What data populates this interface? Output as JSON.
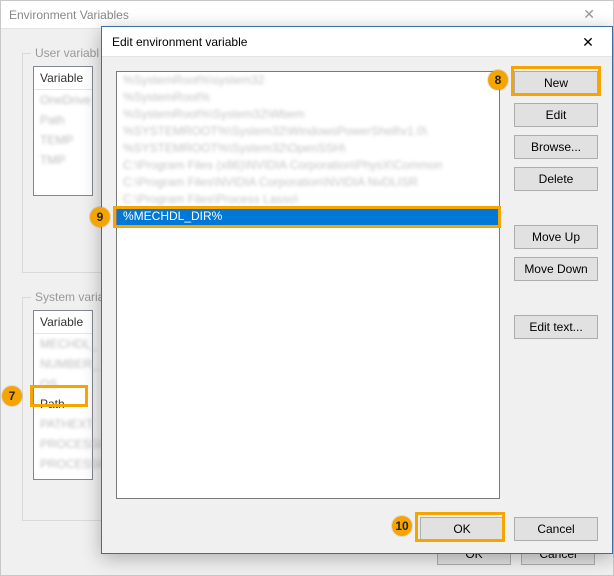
{
  "parent_dialog": {
    "title": "Environment Variables",
    "close_glyph": "✕",
    "user_group_label": "User variabl",
    "system_group_label": "System varia",
    "list_header": "Variable",
    "user_rows": [
      "OneDrive",
      "Path",
      "TEMP",
      "TMP"
    ],
    "system_rows": [
      "MECHDL_",
      "NUMBER_",
      "OS",
      "Path",
      "PATHEXT",
      "PROCESSC",
      "PROCESSC"
    ],
    "ok_label": "OK",
    "cancel_label": "Cancel"
  },
  "edit_dialog": {
    "title": "Edit environment variable",
    "close_glyph": "✕",
    "path_rows": [
      {
        "text": "%SystemRoot%\\system32",
        "selected": false
      },
      {
        "text": "%SystemRoot%",
        "selected": false
      },
      {
        "text": "%SystemRoot%\\System32\\Wbem",
        "selected": false
      },
      {
        "text": "%SYSTEMROOT%\\System32\\WindowsPowerShell\\v1.0\\",
        "selected": false
      },
      {
        "text": "%SYSTEMROOT%\\System32\\OpenSSH\\",
        "selected": false
      },
      {
        "text": "C:\\Program Files (x86)\\NVIDIA Corporation\\PhysX\\Common",
        "selected": false
      },
      {
        "text": "C:\\Program Files\\NVIDIA Corporation\\NVIDIA NvDLISR",
        "selected": false
      },
      {
        "text": "C:\\Program Files\\Process Lasso\\",
        "selected": false
      },
      {
        "text": "%MECHDL_DIR%",
        "selected": true
      }
    ],
    "buttons": {
      "new": "New",
      "edit": "Edit",
      "browse": "Browse...",
      "delete": "Delete",
      "moveup": "Move Up",
      "movedown": "Move Down",
      "edittext": "Edit text..."
    },
    "ok_label": "OK",
    "cancel_label": "Cancel"
  },
  "callouts": {
    "7": "7",
    "8": "8",
    "9": "9",
    "10": "10"
  }
}
